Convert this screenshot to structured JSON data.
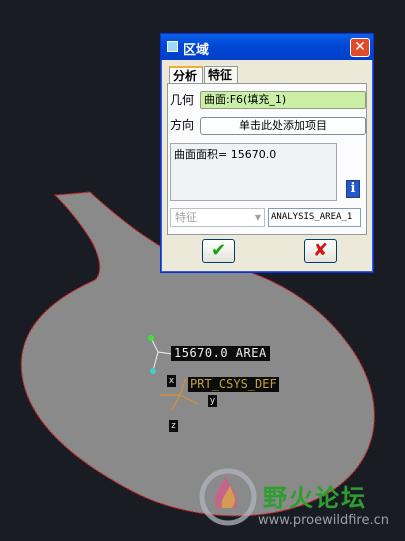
{
  "dialog": {
    "title": "区域",
    "close_label": "✕",
    "tabs": [
      {
        "label": "分析"
      },
      {
        "label": "特征"
      }
    ],
    "geometry_label": "几何",
    "geometry_value": "曲面:F6(填充_1)",
    "direction_label": "方向",
    "direction_button": "单击此处添加项目",
    "result_text": "曲面面积= 15670.0",
    "info_icon": "i",
    "feature_select": "特征",
    "analysis_name": "ANALYSIS_AREA_1",
    "ok_label": "✔",
    "cancel_label": "✘"
  },
  "model": {
    "area_annotation": "15670.0 AREA",
    "csys_label": "PRT_CSYS_DEF",
    "axis_x": "x",
    "axis_y": "y",
    "axis_z": "z"
  },
  "watermark": {
    "brand_text": "野火论坛",
    "url": "www.proewildfire.cn"
  },
  "colors": {
    "background": "#1a1c24",
    "surface_fill": "#8a8a8a",
    "surface_edge": "#d02020",
    "titlebar": "#0047d6",
    "geometry_field": "#ccefa8"
  }
}
